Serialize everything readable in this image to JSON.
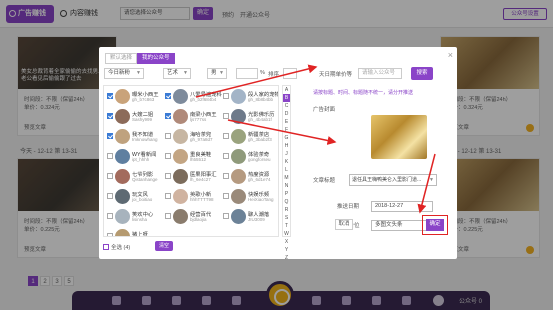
{
  "topbar": {
    "main_tab": "广告赚钱",
    "second_tab": "内容赚钱",
    "account_select": "请您选择公众号",
    "confirm_btn": "确定",
    "link1": "预约",
    "link2": "开通公众号",
    "gzh_btn": "公众号设置"
  },
  "cards": [
    {
      "caption": "美女总裁背着全家偷偷的去找男人，老公看见后偷偷跟了过去",
      "line1": "时间段：不限（保留24h）",
      "line2": "单价：0.324元",
      "foot": "预览文章"
    },
    {
      "caption": "",
      "line1": "时间段：不限（保留24h）",
      "line2": "单价：0.324元",
      "foot": "预览文章"
    },
    {
      "caption": "",
      "line1": "时间段：不限（保留24h）",
      "line2": "单价：0.225元",
      "foot": "预览文章"
    },
    {
      "caption": "",
      "line1": "时间段：不限（保留24h）",
      "line2": "单价：0.225元",
      "foot": "预览文章"
    }
  ],
  "date_rows": [
    "今天 - 12-12 第 13-31",
    "今天 - 12-12 第 13-31"
  ],
  "dialog": {
    "tab_inactive": "默认选择",
    "tab_active": "我的公众号",
    "close": "×",
    "filters": {
      "date": "今日新粉",
      "type": "艺术",
      "sex": "男",
      "pct_label": "%",
      "rank": "排序",
      "range_label": "天日期单价等",
      "search_placeholder": "请输入公众号",
      "search_btn": "搜索"
    },
    "accounts": [
      {
        "name": "曝米小西王",
        "id": "gh_b7c863",
        "checked": true,
        "color": "#c9a37a"
      },
      {
        "name": "八爱号遍宠科",
        "id": "gh_b2f684b4",
        "checked": true,
        "color": "#7e8b9c"
      },
      {
        "name": "段人家的宠物",
        "id": "gh_8b8b4bb",
        "checked": false,
        "color": "#a3b4c7"
      },
      {
        "name": "大嫂二姐",
        "id": "Sashy999",
        "checked": true,
        "color": "#8c6b5a"
      },
      {
        "name": "南梁小西王",
        "id": "ljs777ss",
        "checked": true,
        "color": "#b08a7a"
      },
      {
        "name": "光影佛乐历",
        "id": "gh_4b4ab1f",
        "checked": false,
        "color": "#6e7a8a"
      },
      {
        "name": "我不知道",
        "id": "Imknowhang",
        "checked": true,
        "color": "#bfa27e"
      },
      {
        "name": "海哈茶兜",
        "id": "gh_97a8d7",
        "checked": false,
        "color": "#c7b6a2"
      },
      {
        "name": "新疆茶店",
        "id": "gh_3bab2f3",
        "checked": false,
        "color": "#9aa37e"
      },
      {
        "name": "WY看新闻",
        "id": "ipt_hhhh",
        "checked": false,
        "color": "#5f7fa0"
      },
      {
        "name": "重良美鞋",
        "id": "lh55512",
        "checked": false,
        "color": "#c3a583"
      },
      {
        "name": "体验茶奇",
        "id": "gongforseu",
        "checked": false,
        "color": "#8f9a7b"
      },
      {
        "name": "七爷列影",
        "id": "Qistanhange",
        "checked": false,
        "color": "#a36b5d"
      },
      {
        "name": "医果阳事汇",
        "id": "lh_6e4c27",
        "checked": false,
        "color": "#7c6c5c"
      },
      {
        "name": "热度资源",
        "id": "gh_6d1e74",
        "checked": false,
        "color": "#b59a80"
      },
      {
        "name": "玩文风",
        "id": "joi_boitiao",
        "checked": false,
        "color": "#5e6a73"
      },
      {
        "name": "英歌小新",
        "id": "hhhTTTT98",
        "checked": false,
        "color": "#d0b3a0"
      },
      {
        "name": "快娱乐频",
        "id": "HeiXiaoTang",
        "checked": false,
        "color": "#9a8a7a"
      },
      {
        "name": "笑欢中心",
        "id": "lisinsha",
        "checked": false,
        "color": "#a7b3bd"
      },
      {
        "name": "经营百代",
        "id": "bjdlaojia",
        "checked": false,
        "color": "#8a7c6d"
      },
      {
        "name": "聊人潮落",
        "id": "JIU3009",
        "checked": false,
        "color": "#6c8297"
      },
      {
        "name": "猪上呀",
        "id": "Pigsuishuan",
        "checked": false,
        "color": "#b59a70"
      }
    ],
    "alphabet": [
      "A",
      "B",
      "C",
      "D",
      "E",
      "F",
      "G",
      "H",
      "J",
      "K",
      "L",
      "M",
      "N",
      "P",
      "Q",
      "R",
      "S",
      "T",
      "W",
      "X",
      "Y",
      "Z"
    ],
    "alpha_active": 1,
    "select_all": "全选 (4)",
    "clear_btn": "清空",
    "right": {
      "note": "请按标题、时间、标题随不统一，请分开推送",
      "cover_label": "广告封面",
      "title_label": "文章标题",
      "title_value": "退任具王嗨鸭美仑入里影门道...",
      "date_label": "推送日期",
      "date_value": "2018-12-27",
      "pos_label": "广告位",
      "pos_value": "多图文头条",
      "cancel": "取消",
      "ok": "确定"
    }
  },
  "pager": {
    "pages": [
      "1",
      "2",
      "3",
      "5"
    ],
    "active": 0
  },
  "dock": {
    "user": "公众号 0"
  }
}
